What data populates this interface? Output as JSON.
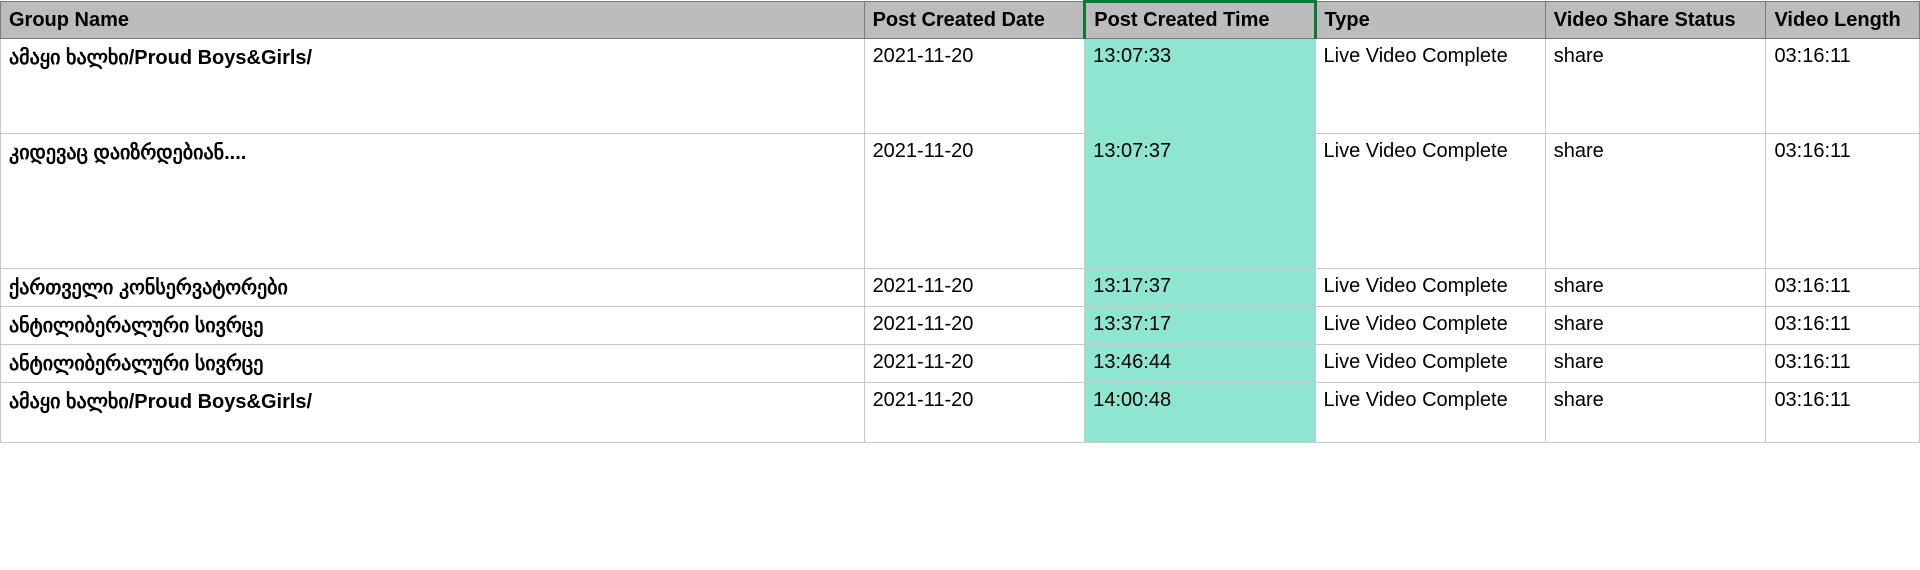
{
  "headers": {
    "group_name": "Group Name",
    "post_created_date": "Post Created Date",
    "post_created_time": "Post Created Time",
    "type": "Type",
    "video_share_status": "Video Share Status",
    "video_length": "Video Length"
  },
  "rows": [
    {
      "group_name": "ამაყი ხალხი/Proud Boys&Girls/",
      "post_created_date": "2021-11-20",
      "post_created_time": "13:07:33",
      "type": "Live Video Complete",
      "video_share_status": "share",
      "video_length": "03:16:11"
    },
    {
      "group_name": "კიდევაც დაიზრდებიან....",
      "post_created_date": "2021-11-20",
      "post_created_time": "13:07:37",
      "type": "Live Video Complete",
      "video_share_status": "share",
      "video_length": "03:16:11"
    },
    {
      "group_name": "ქართველი კონსერვატორები",
      "post_created_date": "2021-11-20",
      "post_created_time": "13:17:37",
      "type": "Live Video Complete",
      "video_share_status": "share",
      "video_length": "03:16:11"
    },
    {
      "group_name": "ანტილიბერალური სივრცე",
      "post_created_date": "2021-11-20",
      "post_created_time": "13:37:17",
      "type": "Live Video Complete",
      "video_share_status": "share",
      "video_length": "03:16:11"
    },
    {
      "group_name": "ანტილიბერალური სივრცე",
      "post_created_date": "2021-11-20",
      "post_created_time": "13:46:44",
      "type": "Live Video Complete",
      "video_share_status": "share",
      "video_length": "03:16:11"
    },
    {
      "group_name": "ამაყი ხალხი/Proud Boys&Girls/",
      "post_created_date": "2021-11-20",
      "post_created_time": "14:00:48",
      "type": "Live Video Complete",
      "video_share_status": "share",
      "video_length": "03:16:11"
    }
  ]
}
